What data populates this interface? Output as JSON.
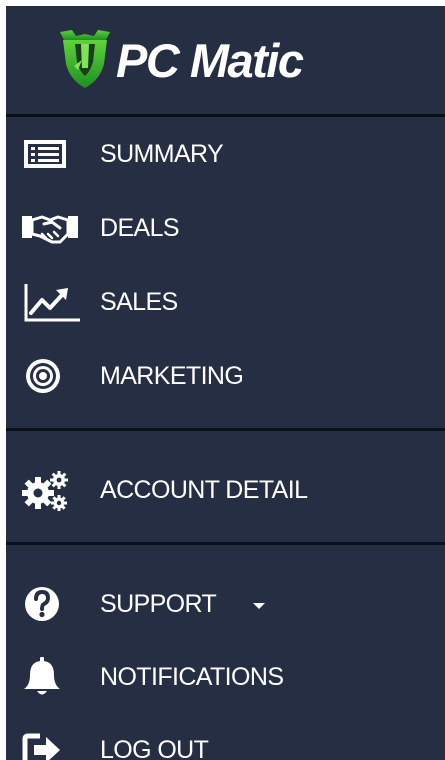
{
  "brand": {
    "name": "PC Matic",
    "logo_icon": "shield-icon",
    "logo_color": "#2aa52a"
  },
  "nav": {
    "items": [
      {
        "label": "SUMMARY",
        "icon": "list-icon"
      },
      {
        "label": "DEALS",
        "icon": "handshake-icon"
      },
      {
        "label": "SALES",
        "icon": "line-chart-icon"
      },
      {
        "label": "MARKETING",
        "icon": "target-icon"
      },
      {
        "label": "ACCOUNT DETAIL",
        "icon": "gears-icon"
      },
      {
        "label": "SUPPORT",
        "icon": "question-icon",
        "has_dropdown": true
      },
      {
        "label": "NOTIFICATIONS",
        "icon": "bell-icon"
      },
      {
        "label": "LOG OUT",
        "icon": "sign-out-icon"
      }
    ]
  },
  "colors": {
    "sidebar_bg": "#252e42",
    "text": "#ffffff",
    "divider": "#0c1119"
  }
}
